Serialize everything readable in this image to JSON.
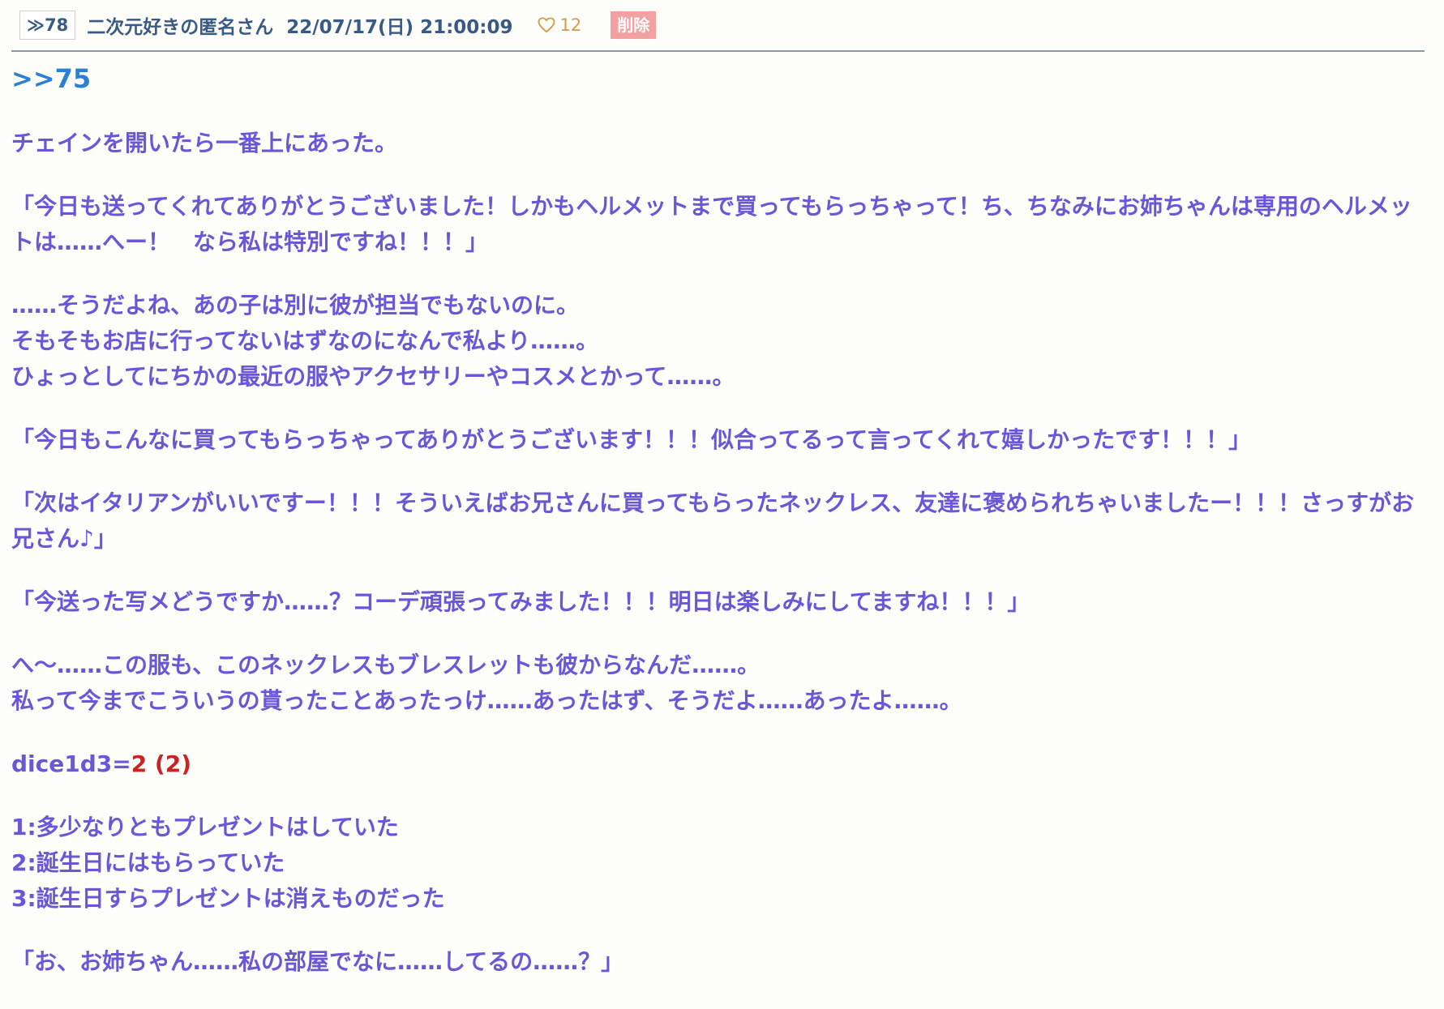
{
  "header": {
    "res_number": "≫78",
    "author": "二次元好きの匿名さん",
    "date": "22/07/17(日) 21:00:09",
    "likes": "12",
    "delete_label": "削除",
    "like_color": "#d59a45",
    "delete_color": "#f2a0a0"
  },
  "body": {
    "anchor": ">>75",
    "p1": "チェインを開いたら一番上にあった。",
    "p2": "「今日も送ってくれてありがとうございました！しかもヘルメットまで買ってもらっちゃって！ち、ちなみにお姉ちゃんは専用のヘルメットは……へー！　なら私は特別ですね！！！」",
    "p3_l1": "……そうだよね、あの子は別に彼が担当でもないのに。",
    "p3_l2": "そもそもお店に行ってないはずなのになんで私より……。",
    "p3_l3": "ひょっとしてにちかの最近の服やアクセサリーやコスメとかって……。",
    "p4": "「今日もこんなに買ってもらっちゃってありがとうございます！！！似合ってるって言ってくれて嬉しかったです！！！」",
    "p5": "「次はイタリアンがいいですー！！！そういえばお兄さんに買ってもらったネックレス、友達に褒められちゃいましたー！！！さっすがお兄さん♪」",
    "p6": "「今送った写メどうですか……？コーデ頑張ってみました！！！明日は楽しみにしてますね！！！」",
    "p7_l1": "へ～……この服も、このネックレスもブレスレットも彼からなんだ……。",
    "p7_l2": "私って今までこういうの貰ったことあったっけ……あったはず、そうだよ……あったよ……。",
    "dice_label": "dice1d3=",
    "dice_value": "2 (2)",
    "opt1": "1:多少なりともプレゼントはしていた",
    "opt2": "2:誕生日にはもらっていた",
    "opt3": "3:誕生日すらプレゼントは消えものだった",
    "p9": "「お、お姉ちゃん……私の部屋でなに……してるの……？」",
    "text_color": "#6a57d8",
    "anchor_color": "#2b7fd4",
    "dice_color": "#cc2222"
  }
}
